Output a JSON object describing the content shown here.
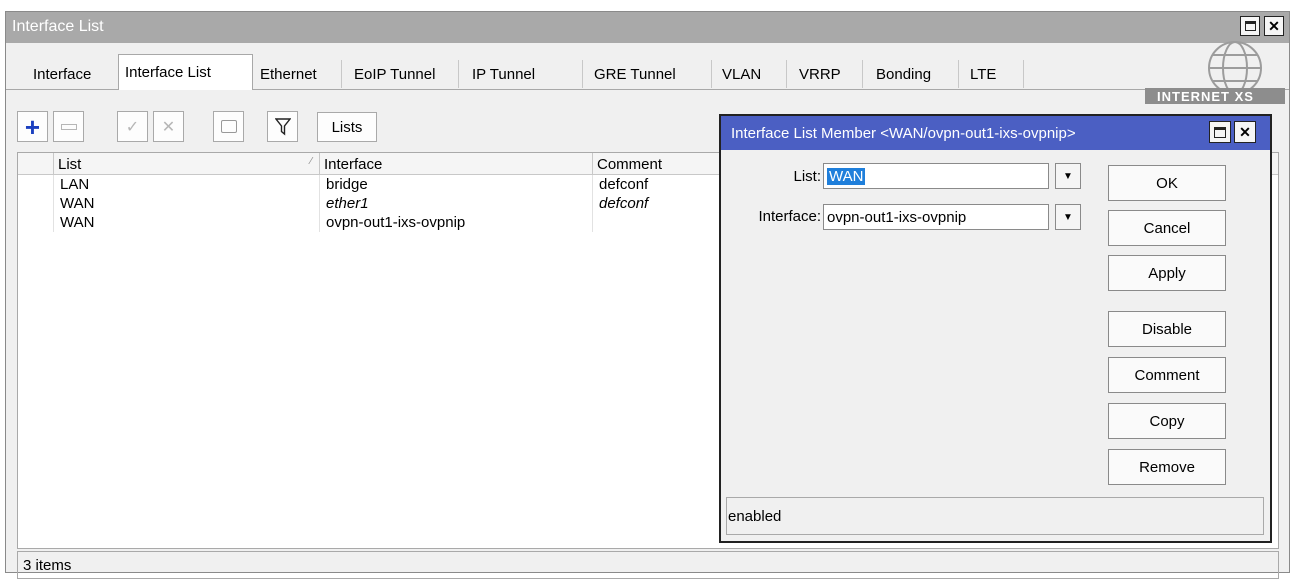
{
  "window": {
    "title": "Interface List"
  },
  "tabs": [
    "Interface",
    "Interface List",
    "Ethernet",
    "EoIP Tunnel",
    "IP Tunnel",
    "GRE Tunnel",
    "VLAN",
    "VRRP",
    "Bonding",
    "LTE"
  ],
  "toolbar": {
    "lists_label": "Lists"
  },
  "table": {
    "columns": [
      "List",
      "Interface",
      "Comment"
    ],
    "rows": [
      {
        "list": "LAN",
        "interface": "bridge",
        "comment": "defconf"
      },
      {
        "list": "WAN",
        "interface": "ether1",
        "comment": "defconf"
      },
      {
        "list": "WAN",
        "interface": "ovpn-out1-ixs-ovpnip",
        "comment": ""
      }
    ]
  },
  "status_text": "3 items",
  "dialog": {
    "title": "Interface List Member <WAN/ovpn-out1-ixs-ovpnip>",
    "list_label": "List:",
    "list_value": "WAN",
    "interface_label": "Interface:",
    "interface_value": "ovpn-out1-ixs-ovpnip",
    "buttons": {
      "ok": "OK",
      "cancel": "Cancel",
      "apply": "Apply",
      "disable": "Disable",
      "comment": "Comment",
      "copy": "Copy",
      "remove": "Remove"
    },
    "status": "enabled"
  },
  "logo": {
    "text": "INTERNET XS"
  },
  "colors": {
    "dialog_title_bg": "#4b5fc3",
    "selection": "#1f7fdb",
    "add_icon": "#1a3fbf"
  }
}
